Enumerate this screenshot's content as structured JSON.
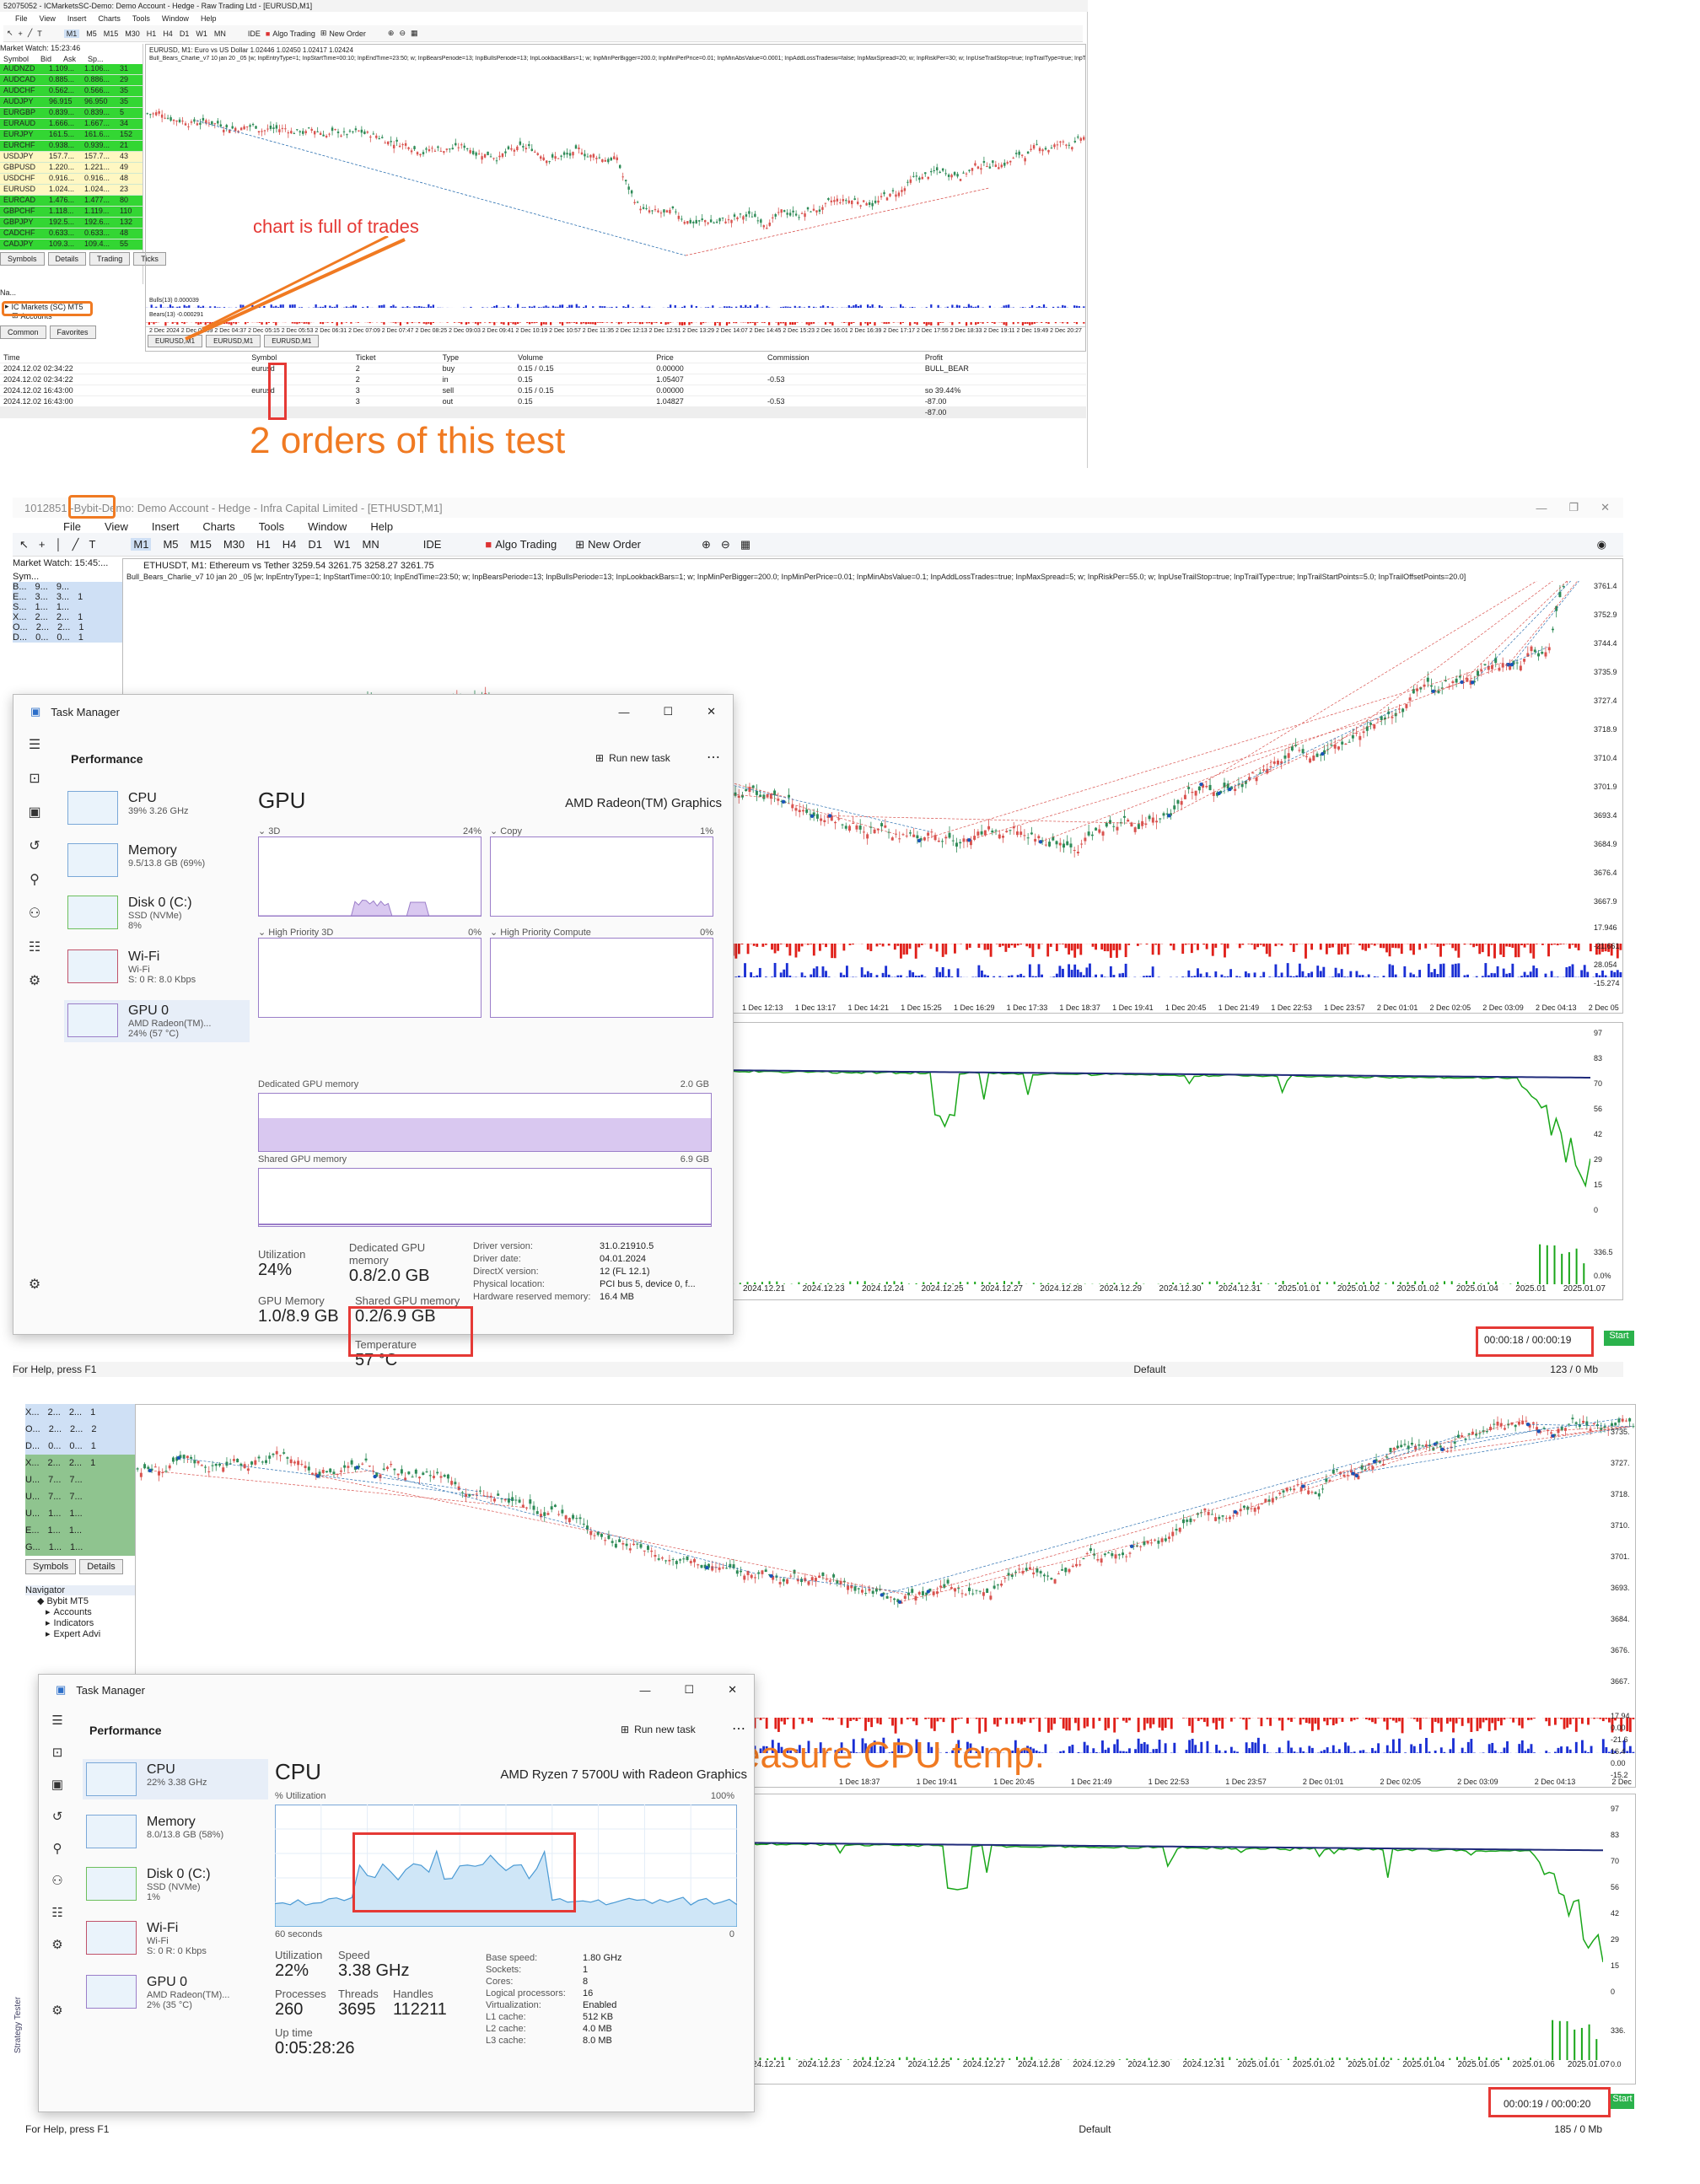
{
  "p1": {
    "window_title": "52075052 - ICMarketsSC-Demo: Demo Account - Hedge - Raw Trading Ltd - [EURUSD,M1]",
    "menu": [
      "File",
      "View",
      "Insert",
      "Charts",
      "Tools",
      "Window",
      "Help"
    ],
    "toolbar": {
      "algo_trading": "Algo Trading",
      "new_order": "New Order",
      "ide": "IDE",
      "timeframes": [
        "M1",
        "M5",
        "M15",
        "M30",
        "H1",
        "H4",
        "D1",
        "W1",
        "MN"
      ]
    },
    "market_watch": {
      "title": "Market Watch: 15:23:46",
      "headers": [
        "Symbol",
        "Bid",
        "Ask",
        "Sp..."
      ],
      "rows": [
        [
          "AUDNZD",
          "1.109...",
          "1.106...",
          "31"
        ],
        [
          "AUDCAD",
          "0.885...",
          "0.886...",
          "29"
        ],
        [
          "AUDCHF",
          "0.562...",
          "0.566...",
          "35"
        ],
        [
          "AUDJPY",
          "96.915",
          "96.950",
          "35"
        ],
        [
          "EURGBP",
          "0.839...",
          "0.839...",
          "5"
        ],
        [
          "EURAUD",
          "1.666...",
          "1.667...",
          "34"
        ],
        [
          "EURJPY",
          "161.5...",
          "161.6...",
          "152"
        ],
        [
          "EURCHF",
          "0.938...",
          "0.939...",
          "21"
        ],
        [
          "USDJPY",
          "157.7...",
          "157.7...",
          "43"
        ],
        [
          "GBPUSD",
          "1.220...",
          "1.221...",
          "49"
        ],
        [
          "USDCHF",
          "0.916...",
          "0.916...",
          "48"
        ],
        [
          "EURUSD",
          "1.024...",
          "1.024...",
          "23"
        ],
        [
          "EURCAD",
          "1.476...",
          "1.477...",
          "80"
        ],
        [
          "GBPCHF",
          "1.118...",
          "1.119...",
          "110"
        ],
        [
          "GBPJPY",
          "192.5...",
          "192.6...",
          "132"
        ],
        [
          "CADCHF",
          "0.633...",
          "0.633...",
          "48"
        ],
        [
          "CADJPY",
          "109.3...",
          "109.4...",
          "55"
        ]
      ],
      "tabs": [
        "Symbols",
        "Details",
        "Trading",
        "Ticks"
      ]
    },
    "navigator": {
      "title": "Na...",
      "broker": "IC Markets (SC) MT5",
      "accounts": "Accounts",
      "tabs": [
        "Common",
        "Favorites"
      ]
    },
    "chart": {
      "header": "EURUSD, M1: Euro vs US Dollar 1.02446 1.02450 1.02417 1.02424",
      "ea_line": "Bull_Bears_Charlie_v7 10 jan 20 _05 [w; InpEntryType=1; InpStartTime=00:10; InpEndTime=23:50; w; InpBearsPeriode=13; InpBullsPeriode=13; InpLookbackBars=1; w; InpMinPerBigger=200.0; InpMinPerPrice=0.01; InpMinAbsValue=0.0001; InpAddLossTradesw=false; InpMaxSpread=20; w; InpRiskPer=30; w; InpUseTrailStop=true; InpTrailType=true; InpTrailStartPoints=5.0",
      "bulls_label": "Bulls(13) 0.000039",
      "bears_label": "Bears(13) -0.000291",
      "time_labels": [
        "2 Dec 2024",
        "2 Dec 03:59",
        "2 Dec 04:37",
        "2 Dec 05:15",
        "2 Dec 05:53",
        "2 Dec 06:31",
        "2 Dec 07:09",
        "2 Dec 07:47",
        "2 Dec 08:25",
        "2 Dec 09:03",
        "2 Dec 09:41",
        "2 Dec 10:19",
        "2 Dec 10:57",
        "2 Dec 11:35",
        "2 Dec 12:13",
        "2 Dec 12:51",
        "2 Dec 13:29",
        "2 Dec 14:07",
        "2 Dec 14:45",
        "2 Dec 15:23",
        "2 Dec 16:01",
        "2 Dec 16:39",
        "2 Dec 17:17",
        "2 Dec 17:55",
        "2 Dec 18:33",
        "2 Dec 19:11",
        "2 Dec 19:49",
        "2 Dec 20:27"
      ],
      "tabs": [
        "EURUSD,M1",
        "EURUSD,M1",
        "EURUSD,M1"
      ]
    },
    "deals": {
      "headers": [
        "Time",
        "Symbol",
        "Ticket",
        "Type",
        "Volume",
        "Price",
        "Commission",
        "Profit"
      ],
      "rows": [
        [
          "2024.12.02 02:34:22",
          "eurusd",
          "2",
          "buy",
          "0.15 / 0.15",
          "0.00000",
          "",
          "BULL_BEAR"
        ],
        [
          "2024.12.02 02:34:22",
          "",
          "2",
          "in",
          "0.15",
          "1.05407",
          "-0.53",
          ""
        ],
        [
          "2024.12.02 16:43:00",
          "eurusd",
          "3",
          "sell",
          "0.15 / 0.15",
          "0.00000",
          "",
          "so 39.44%"
        ],
        [
          "2024.12.02 16:43:00",
          "",
          "3",
          "out",
          "0.15",
          "1.04827",
          "-0.53",
          "-87.00"
        ]
      ],
      "total": "-87.00"
    },
    "annotations": {
      "chart_full": "chart is full of trades",
      "two_orders": "2 orders of this test"
    }
  },
  "p2": {
    "window_title_prefix": "1012851 - ",
    "broker_highlight": "Bybit",
    "window_title_rest": "-Demo: Demo Account - Hedge - Infra Capital Limited - [ETHUSDT,M1]",
    "menu": [
      "File",
      "View",
      "Insert",
      "Charts",
      "Tools",
      "Window",
      "Help"
    ],
    "toolbar": {
      "algo_trading": "Algo Trading",
      "new_order": "New Order",
      "ide": "IDE",
      "timeframes": [
        "M1",
        "M5",
        "M15",
        "M30",
        "H1",
        "H4",
        "D1",
        "W1",
        "MN"
      ]
    },
    "market_watch": {
      "title": "Market Watch: 15:45:...",
      "col": "Sym...",
      "rows": [
        [
          "B...",
          "9...",
          "9...",
          ""
        ],
        [
          "E...",
          "3...",
          "3...",
          "1"
        ],
        [
          "S...",
          "1...",
          "1...",
          ""
        ],
        [
          "X...",
          "2...",
          "2...",
          "1"
        ],
        [
          "O...",
          "2...",
          "2...",
          "1"
        ],
        [
          "D...",
          "0...",
          "0...",
          "1"
        ]
      ]
    },
    "chart": {
      "header": "ETHUSDT, M1: Ethereum vs Tether 3259.54 3261.75 3258.27 3261.75",
      "ea_line": "Bull_Bears_Charlie_v7 10 jan 20 _05 [w; InpEntryType=1; InpStartTime=00:10; InpEndTime=23:50; w; InpBearsPeriode=13; InpBullsPeriode=13; InpLookbackBars=1; w; InpMinPerBigger=200.0; InpMinPerPrice=0.01; InpMinAbsValue=0.1; InpAddLossTrades=true; InpMaxSpread=5; w; InpRiskPer=55.0; w; InpUseTrailStop=true; InpTrailType=true; InpTrailStartPoints=5.0; InpTrailOffsetPoints=20.0]",
      "price_labels": [
        "3761.4",
        "3752.9",
        "3744.4",
        "3735.9",
        "3727.4",
        "3718.9",
        "3710.4",
        "3701.9",
        "3693.4",
        "3684.9",
        "3676.4",
        "3667.9"
      ],
      "ind_labels": [
        "17.946",
        "-21.661",
        "28.054",
        "-15.274"
      ],
      "time_labels": [
        "1 Dec 12:13",
        "1 Dec 13:17",
        "1 Dec 14:21",
        "1 Dec 15:25",
        "1 Dec 16:29",
        "1 Dec 17:33",
        "1 Dec 18:37",
        "1 Dec 19:41",
        "1 Dec 20:45",
        "1 Dec 21:49",
        "1 Dec 22:53",
        "1 Dec 23:57",
        "2 Dec 01:01",
        "2 Dec 02:05",
        "2 Dec 03:09",
        "2 Dec 04:13",
        "2 Dec 05"
      ]
    },
    "graph": {
      "y_labels": [
        "97",
        "83",
        "70",
        "56",
        "42",
        "29",
        "15",
        "0"
      ],
      "y2_labels": [
        "336.5",
        "0.0%"
      ],
      "x_labels": [
        "2024.12.21",
        "2024.12.23",
        "2024.12.24",
        "2024.12.25",
        "2024.12.27",
        "2024.12.28",
        "2024.12.29",
        "2024.12.30",
        "2024.12.31",
        "2025.01.01",
        "2025.01.02",
        "2025.01.02",
        "2025.01.04",
        "2025.01",
        "2025.01.07"
      ],
      "tabs": [
        "Overview",
        "Settings",
        "Inputs",
        "Backtest",
        "Graph",
        "Agents",
        "Journal"
      ],
      "timer": "00:00:18 / 00:00:19",
      "start": "Start"
    },
    "status": {
      "help": "For Help, press F1",
      "profile": "Default",
      "mem": "123 / 0 Mb"
    },
    "task_manager": {
      "title": "Task Manager",
      "section": "Performance",
      "run_task": "Run new task",
      "side": [
        {
          "name": "CPU",
          "sub1": "39% 3.26 GHz",
          "sub2": ""
        },
        {
          "name": "Memory",
          "sub1": "9.5/13.8 GB (69%)",
          "sub2": ""
        },
        {
          "name": "Disk 0 (C:)",
          "sub1": "SSD (NVMe)",
          "sub2": "8%"
        },
        {
          "name": "Wi-Fi",
          "sub1": "Wi-Fi",
          "sub2": "S: 0 R: 8.0 Kbps"
        },
        {
          "name": "GPU 0",
          "sub1": "AMD Radeon(TM)...",
          "sub2": "24% (57 °C)"
        }
      ],
      "heading": "GPU",
      "device": "AMD Radeon(TM) Graphics",
      "graphs": [
        {
          "left": "3D",
          "right": "24%"
        },
        {
          "left": "Copy",
          "right": "1%"
        },
        {
          "left": "High Priority 3D",
          "right": "0%"
        },
        {
          "left": "High Priority Compute",
          "right": "0%"
        }
      ],
      "dedicated_label": "Dedicated GPU memory",
      "dedicated_max": "2.0 GB",
      "shared_label": "Shared GPU memory",
      "shared_max": "6.9 GB",
      "stats": {
        "util_l": "Utilization",
        "util_v": "24%",
        "ded_l": "Dedicated GPU memory",
        "ded_v": "0.8/2.0 GB",
        "gpumem_l": "GPU Memory",
        "gpumem_v": "1.0/8.9 GB",
        "shared_l": "Shared GPU memory",
        "shared_v": "0.2/6.9 GB",
        "temp_l": "Temperature",
        "temp_v": "57 °C"
      },
      "info": [
        [
          "Driver version:",
          "31.0.21910.5"
        ],
        [
          "Driver date:",
          "04.01.2024"
        ],
        [
          "DirectX version:",
          "12 (FL 12.1)"
        ],
        [
          "Physical location:",
          "PCI bus 5, device 0, f..."
        ],
        [
          "Hardware reserved memory:",
          "16.4 MB"
        ]
      ]
    }
  },
  "p3": {
    "market_watch": {
      "rows": [
        [
          "X...",
          "2...",
          "2...",
          "1"
        ],
        [
          "O...",
          "2...",
          "2...",
          "2"
        ],
        [
          "D...",
          "0...",
          "0...",
          "1"
        ],
        [
          "X...",
          "2...",
          "2...",
          "1"
        ],
        [
          "U...",
          "7...",
          "7...",
          ""
        ],
        [
          "U...",
          "7...",
          "7...",
          ""
        ],
        [
          "U...",
          "1...",
          "1...",
          ""
        ],
        [
          "E...",
          "1...",
          "1...",
          ""
        ],
        [
          "G...",
          "1...",
          "1...",
          ""
        ]
      ],
      "tabs": [
        "Symbols",
        "Details"
      ]
    },
    "navigator": {
      "title": "Navigator",
      "broker": "Bybit MT5",
      "items": [
        "Accounts",
        "Indicators",
        "Expert Advi"
      ]
    },
    "chart": {
      "price_labels": [
        "3735.",
        "3727.",
        "3718.",
        "3710.",
        "3701.",
        "3693.",
        "3684.",
        "3676.",
        "3667."
      ],
      "ind_labels": [
        "17.94",
        "0.00",
        "-21.6",
        "16.4",
        "0.00",
        "-15.2"
      ],
      "time_labels": [
        "1 Dec 18:37",
        "1 Dec 19:41",
        "1 Dec 20:45",
        "1 Dec 21:49",
        "1 Dec 22:53",
        "1 Dec 23:57",
        "2 Dec 01:01",
        "2 Dec 02:05",
        "2 Dec 03:09",
        "2 Dec 04:13",
        "2 Dec"
      ]
    },
    "graph": {
      "y_labels": [
        "97",
        "83",
        "70",
        "56",
        "42",
        "29",
        "15",
        "0"
      ],
      "y2_labels": [
        "336.",
        "0.0"
      ],
      "x_labels": [
        "2024.12.21",
        "2024.12.23",
        "2024.12.24",
        "2024.12.25",
        "2024.12.27",
        "2024.12.28",
        "2024.12.29",
        "2024.12.30",
        "2024.12.31",
        "2025.01.01",
        "2025.01.02",
        "2025.01.02",
        "2025.01.04",
        "2025.01.05",
        "2025.01.06",
        "2025.01.07"
      ],
      "tabs": [
        "Overview",
        "Settings",
        "Inputs",
        "Backtest",
        "Graph",
        "Agents",
        "Journal"
      ],
      "timer": "00:00:19 / 00:00:20",
      "start": "Start",
      "side_label": "Strategy Tester"
    },
    "status": {
      "help": "For Help, press F1",
      "profile": "Default",
      "mem": "185 / 0 Mb"
    },
    "annotation": "Not sure how to measure CPU temp.",
    "task_manager": {
      "title": "Task Manager",
      "section": "Performance",
      "run_task": "Run new task",
      "side": [
        {
          "name": "CPU",
          "sub1": "22% 3.38 GHz",
          "sub2": ""
        },
        {
          "name": "Memory",
          "sub1": "8.0/13.8 GB (58%)",
          "sub2": ""
        },
        {
          "name": "Disk 0 (C:)",
          "sub1": "SSD (NVMe)",
          "sub2": "1%"
        },
        {
          "name": "Wi-Fi",
          "sub1": "Wi-Fi",
          "sub2": "S: 0 R: 0 Kbps"
        },
        {
          "name": "GPU 0",
          "sub1": "AMD Radeon(TM)...",
          "sub2": "2% (35 °C)"
        }
      ],
      "heading": "CPU",
      "device": "AMD Ryzen 7 5700U with Radeon Graphics",
      "graph_label": "% Utilization",
      "graph_max": "100%",
      "graph_time": "60 seconds",
      "graph_min": "0",
      "stats": {
        "util_l": "Utilization",
        "util_v": "22%",
        "speed_l": "Speed",
        "speed_v": "3.38 GHz",
        "proc_l": "Processes",
        "proc_v": "260",
        "thr_l": "Threads",
        "thr_v": "3695",
        "hnd_l": "Handles",
        "hnd_v": "112211",
        "up_l": "Up time",
        "up_v": "0:05:28:26"
      },
      "info": [
        [
          "Base speed:",
          "1.80 GHz"
        ],
        [
          "Sockets:",
          "1"
        ],
        [
          "Cores:",
          "8"
        ],
        [
          "Logical processors:",
          "16"
        ],
        [
          "Virtualization:",
          "Enabled"
        ],
        [
          "L1 cache:",
          "512 KB"
        ],
        [
          "L2 cache:",
          "4.0 MB"
        ],
        [
          "L3 cache:",
          "8.0 MB"
        ]
      ]
    }
  },
  "colors": {
    "accent_orange": "#f07a22",
    "highlight_red": "#e53935",
    "candle_up": "#2e8b57",
    "candle_down": "#d9534f",
    "bulls": "#1a2fd4",
    "bears": "#e0201a",
    "balance": "#1f2a7a",
    "equity": "#19a619"
  }
}
